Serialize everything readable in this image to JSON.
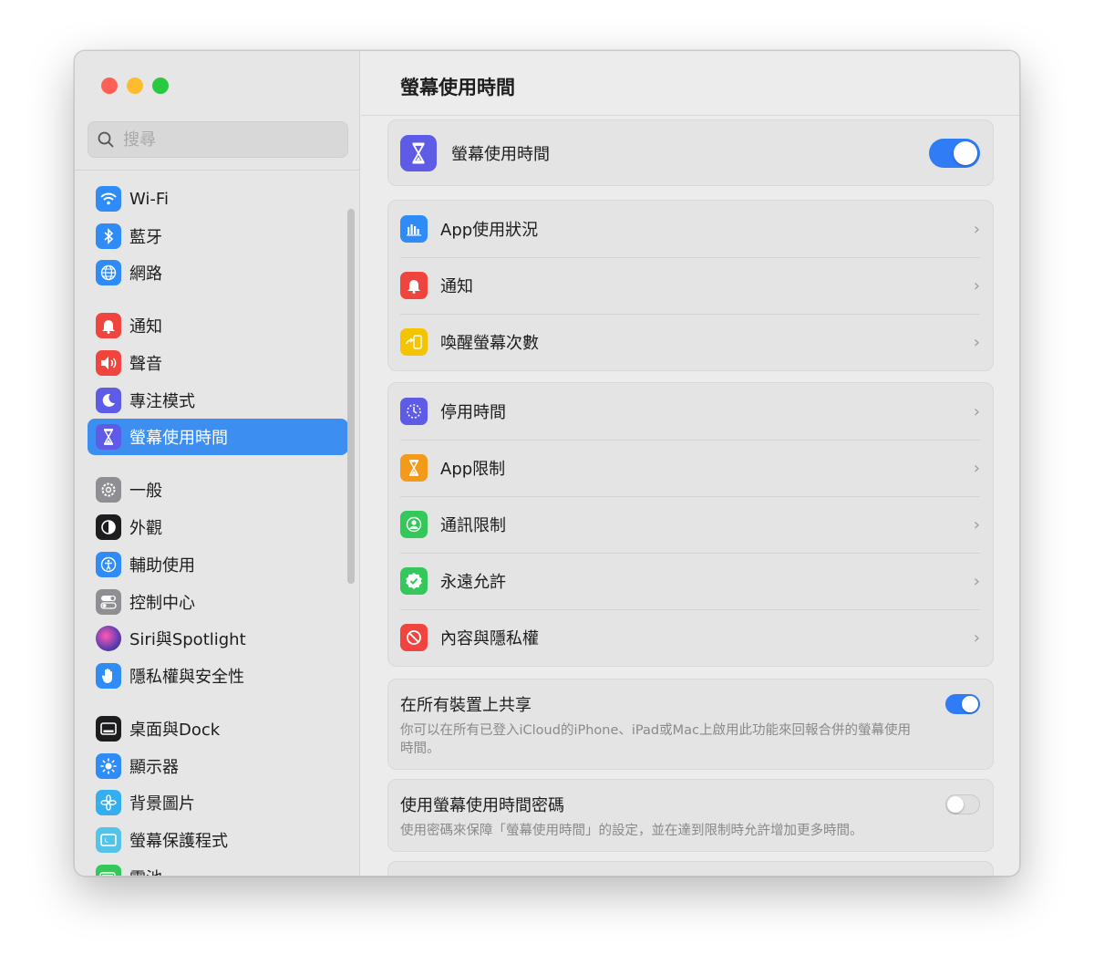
{
  "window": {
    "traffic_colors": [
      "#fe5f57",
      "#febc2e",
      "#28c840"
    ]
  },
  "search": {
    "placeholder": "搜尋"
  },
  "sidebar": {
    "items": [
      {
        "label": "Wi-Fi",
        "icon": "wifi-icon",
        "color": "#2f8cf6"
      },
      {
        "label": "藍牙",
        "icon": "bluetooth-icon",
        "color": "#2f8cf6"
      },
      {
        "label": "網路",
        "icon": "globe-icon",
        "color": "#2f8cf6"
      },
      {
        "label": "通知",
        "icon": "bell-icon",
        "color": "#f0443e"
      },
      {
        "label": "聲音",
        "icon": "speaker-icon",
        "color": "#f0443e"
      },
      {
        "label": "專注模式",
        "icon": "moon-icon",
        "color": "#5e5ce6"
      },
      {
        "label": "螢幕使用時間",
        "icon": "hourglass-icon",
        "color": "#5e5ce6",
        "active": true
      },
      {
        "label": "一般",
        "icon": "gear-icon",
        "color": "#8e8e93"
      },
      {
        "label": "外觀",
        "icon": "appearance-icon",
        "color": "#1d1d1f"
      },
      {
        "label": "輔助使用",
        "icon": "accessibility-icon",
        "color": "#2f8cf6"
      },
      {
        "label": "控制中心",
        "icon": "control-center-icon",
        "color": "#8e8e93"
      },
      {
        "label": "Siri與Spotlight",
        "icon": "siri-icon",
        "color": "#6a3fb3"
      },
      {
        "label": "隱私權與安全性",
        "icon": "hand-icon",
        "color": "#2f8cf6"
      },
      {
        "label": "桌面與Dock",
        "icon": "dock-icon",
        "color": "#1d1d1f"
      },
      {
        "label": "顯示器",
        "icon": "sun-icon",
        "color": "#2f8cf6"
      },
      {
        "label": "背景圖片",
        "icon": "flower-icon",
        "color": "#35aef0"
      },
      {
        "label": "螢幕保護程式",
        "icon": "screensaver-icon",
        "color": "#55c3e8"
      },
      {
        "label": "電池",
        "icon": "battery-icon",
        "color": "#34c759"
      }
    ]
  },
  "main": {
    "title": "螢幕使用時間",
    "header_row": {
      "label": "螢幕使用時間",
      "icon": "hourglass-icon",
      "toggle_on": true
    },
    "group1": [
      {
        "label": "App使用狀況",
        "icon": "bar-chart-icon",
        "color": "#2f8cf6"
      },
      {
        "label": "通知",
        "icon": "bell-icon",
        "color": "#f0443e"
      },
      {
        "label": "喚醒螢幕次數",
        "icon": "pickup-icon",
        "color": "#f5c400"
      }
    ],
    "group2": [
      {
        "label": "停用時間",
        "icon": "downtime-icon",
        "color": "#5e5ce6"
      },
      {
        "label": "App限制",
        "icon": "hourglass-icon",
        "color": "#f39a1b"
      },
      {
        "label": "通訊限制",
        "icon": "contact-icon",
        "color": "#34c759"
      },
      {
        "label": "永遠允許",
        "icon": "checkmark-badge-icon",
        "color": "#34c759"
      },
      {
        "label": "內容與隱私權",
        "icon": "restricted-icon",
        "color": "#f0443e"
      }
    ],
    "share": {
      "title": "在所有裝置上共享",
      "description": "你可以在所有已登入iCloud的iPhone、iPad或Mac上啟用此功能來回報合併的螢幕使用時間。",
      "toggle_on": true
    },
    "passcode": {
      "title": "使用螢幕使用時間密碼",
      "description": "使用密碼來保障「螢幕使用時間」的設定，並在達到限制時允許增加更多時間。",
      "toggle_on": false
    }
  }
}
